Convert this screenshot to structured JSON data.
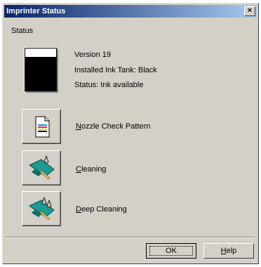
{
  "window": {
    "title": "Imprinter Status",
    "close_glyph": "×"
  },
  "status": {
    "label": "Status",
    "version": "Version 19",
    "installed_tank": "Installed Ink Tank: Black",
    "status_text": "Status: Ink available",
    "tank_icon": "black-ink-tank-icon"
  },
  "actions": {
    "nozzle": {
      "mnemonic": "N",
      "rest": "ozzle Check Pattern",
      "icon": "nozzle-check-pattern-icon"
    },
    "cleaning": {
      "mnemonic": "C",
      "rest": "leaning",
      "icon": "cleaning-icon"
    },
    "deep": {
      "mnemonic": "D",
      "rest": "eep Cleaning",
      "icon": "deep-cleaning-icon"
    }
  },
  "buttons": {
    "ok": "OK",
    "help_mnemonic": "H",
    "help_rest": "elp"
  },
  "colors": {
    "titlebar_start": "#0a246a",
    "titlebar_end": "#a6caf0",
    "dialog_face": "#d4d0c8",
    "accent_teal": "#1e9a92"
  }
}
